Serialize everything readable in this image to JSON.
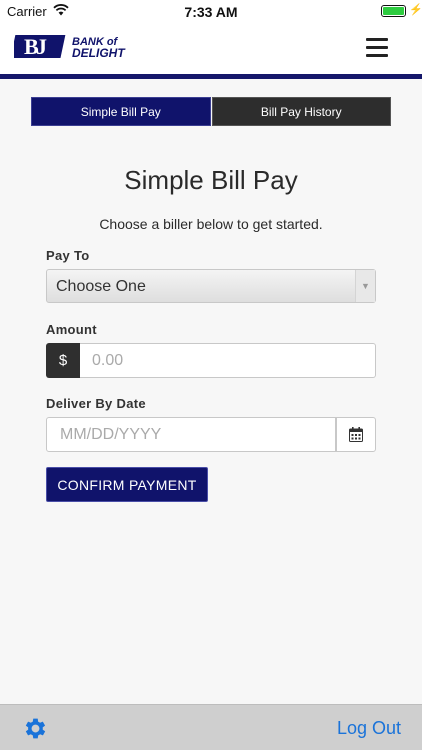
{
  "status_bar": {
    "carrier": "Carrier",
    "time": "7:33 AM",
    "battery_level": 1.0
  },
  "header": {
    "logo_line1": "BANK of",
    "logo_line2": "DELIGHT",
    "logo_mark": "B"
  },
  "tabs": [
    {
      "label": "Simple Bill Pay",
      "active": true
    },
    {
      "label": "Bill Pay History",
      "active": false
    }
  ],
  "page": {
    "title": "Simple Bill Pay",
    "subtitle": "Choose a biller below to get started."
  },
  "form": {
    "pay_to_label": "Pay To",
    "pay_to_value": "Choose One",
    "amount_label": "Amount",
    "currency_symbol": "$",
    "amount_placeholder": "0.00",
    "date_label": "Deliver By Date",
    "date_placeholder": "MM/DD/YYYY",
    "confirm_label": "CONFIRM PAYMENT"
  },
  "bottom_bar": {
    "logout_label": "Log Out"
  },
  "icons": {
    "wifi": "wifi-icon",
    "battery": "battery-icon",
    "menu": "hamburger-icon",
    "calendar": "calendar-icon",
    "settings": "gear-icon",
    "dropdown": "chevron-down-icon"
  },
  "colors": {
    "brand_navy": "#10136b",
    "link_blue": "#1a73d9",
    "tab_inactive": "#2d2d2d"
  }
}
